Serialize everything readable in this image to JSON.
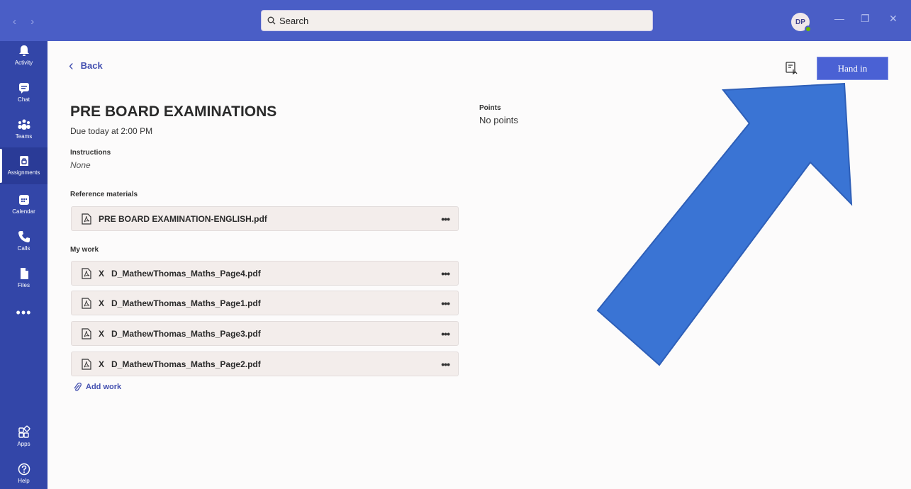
{
  "titlebar": {
    "search_placeholder": "Search",
    "avatar_initials": "DP"
  },
  "rail": {
    "items": [
      {
        "label": "Activity",
        "icon": "bell-icon"
      },
      {
        "label": "Chat",
        "icon": "chat-icon"
      },
      {
        "label": "Teams",
        "icon": "teams-icon"
      },
      {
        "label": "Assignments",
        "icon": "assignments-icon"
      },
      {
        "label": "Calendar",
        "icon": "calendar-icon"
      },
      {
        "label": "Calls",
        "icon": "phone-icon"
      },
      {
        "label": "Files",
        "icon": "file-icon"
      },
      {
        "label": "Apps",
        "icon": "apps-icon"
      },
      {
        "label": "Help",
        "icon": "help-icon"
      }
    ],
    "more": "•••"
  },
  "assignment": {
    "back_label": "Back",
    "title": "PRE BOARD EXAMINATIONS",
    "due": "Due today at 2:00 PM",
    "instructions_label": "Instructions",
    "instructions_value": "None",
    "points_label": "Points",
    "points_value": "No points",
    "reference_label": "Reference materials",
    "reference_files": [
      "PRE BOARD EXAMINATION-ENGLISH.pdf"
    ],
    "mywork_label": "My work",
    "work_files": [
      "D_MathewThomas_Maths_Page4.pdf",
      "D_MathewThomas_Maths_Page1.pdf",
      "D_MathewThomas_Maths_Page3.pdf",
      "D_MathewThomas_Maths_Page2.pdf"
    ],
    "remove_label": "X",
    "more_label": "•••",
    "add_work_label": "Add work",
    "hand_in_label": "Hand in"
  },
  "colors": {
    "titlebar": "#4a5ec6",
    "rail": "#3346a8",
    "accent": "#4450b0",
    "hand_in": "#4a61d4",
    "annotation_arrow": "#3a74d4"
  }
}
